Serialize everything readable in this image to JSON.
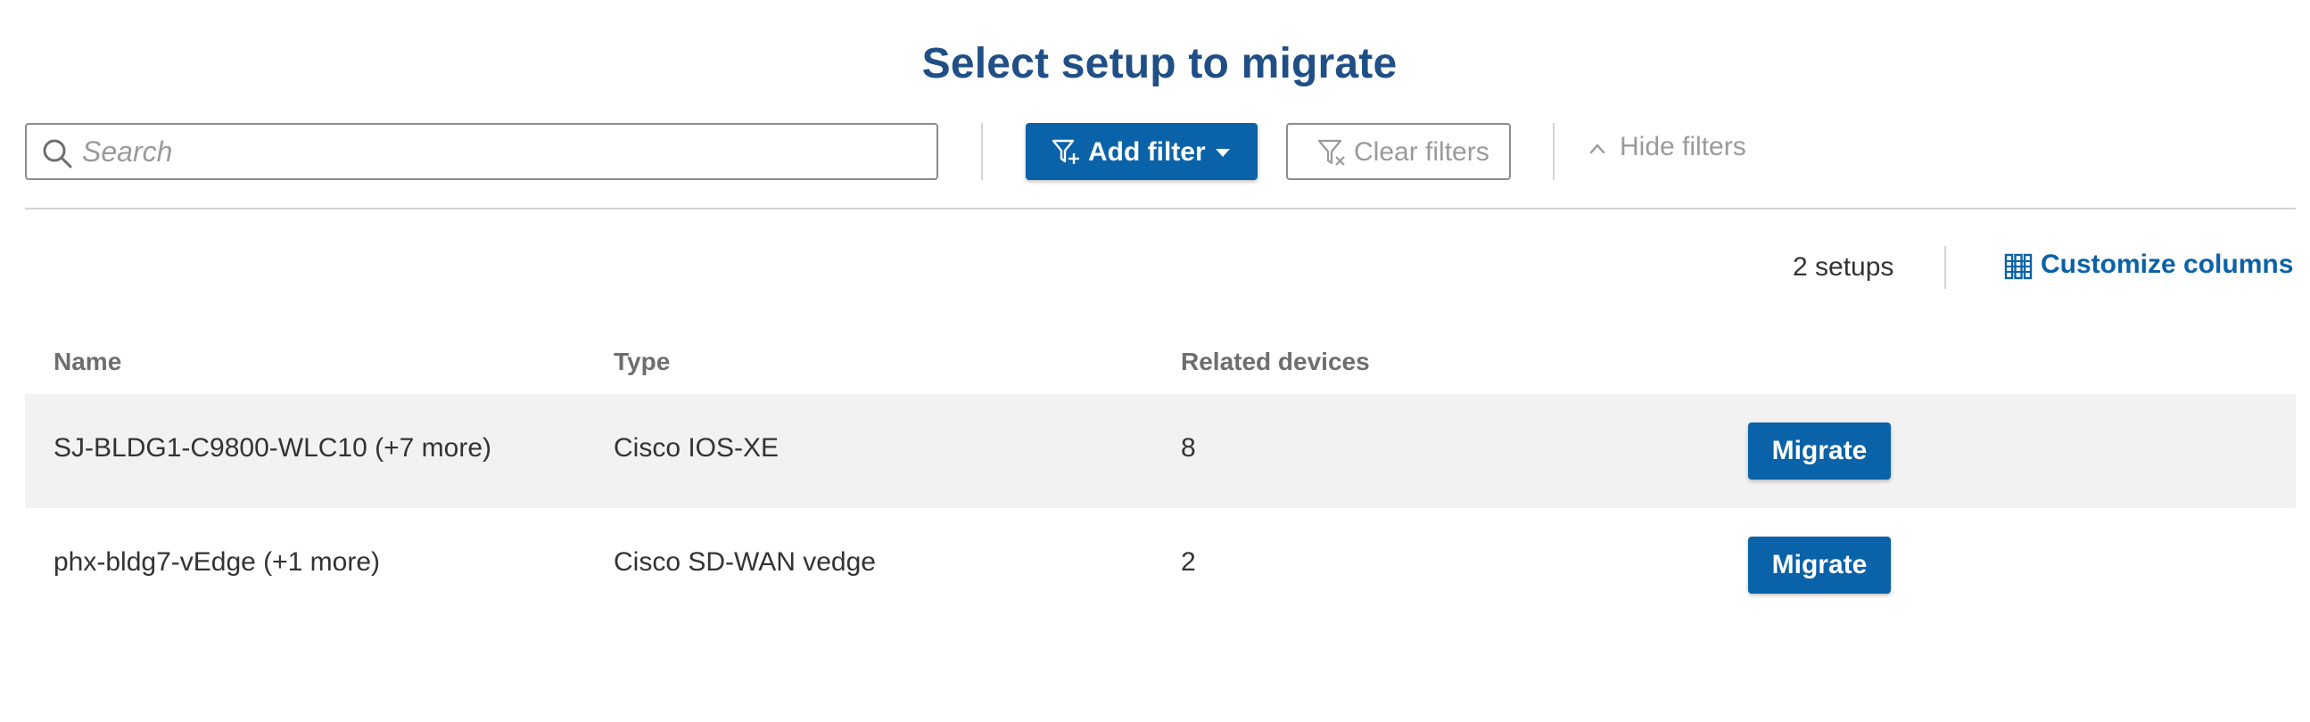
{
  "header": {
    "title": "Select setup to migrate"
  },
  "filters": {
    "search_placeholder": "Search",
    "search_value": "",
    "add_filter_label": "Add filter",
    "clear_filters_label": "Clear filters",
    "hide_filters_label": "Hide filters"
  },
  "summary": {
    "count_label": "2 setups",
    "customize_label": "Customize columns"
  },
  "table": {
    "columns": [
      "Name",
      "Type",
      "Related devices"
    ],
    "rows": [
      {
        "name": "SJ-BLDG1-C9800-WLC10 (+7 more)",
        "type": "Cisco IOS-XE",
        "related_devices": "8",
        "action": "Migrate"
      },
      {
        "name": "phx-bldg7-vEdge (+1 more)",
        "type": "Cisco SD-WAN vedge",
        "related_devices": "2",
        "action": "Migrate"
      }
    ]
  },
  "colors": {
    "title": "#1f4f86",
    "primary": "#0a62a8",
    "muted": "#9a9a9a",
    "row_shade": "#f2f2f2"
  },
  "icons": {
    "search": "search-icon",
    "add_filter": "filter-add-icon",
    "dropdown": "caret-down-icon",
    "clear_filters": "filter-clear-icon",
    "hide_filters": "chevron-up-icon",
    "customize": "columns-icon"
  }
}
